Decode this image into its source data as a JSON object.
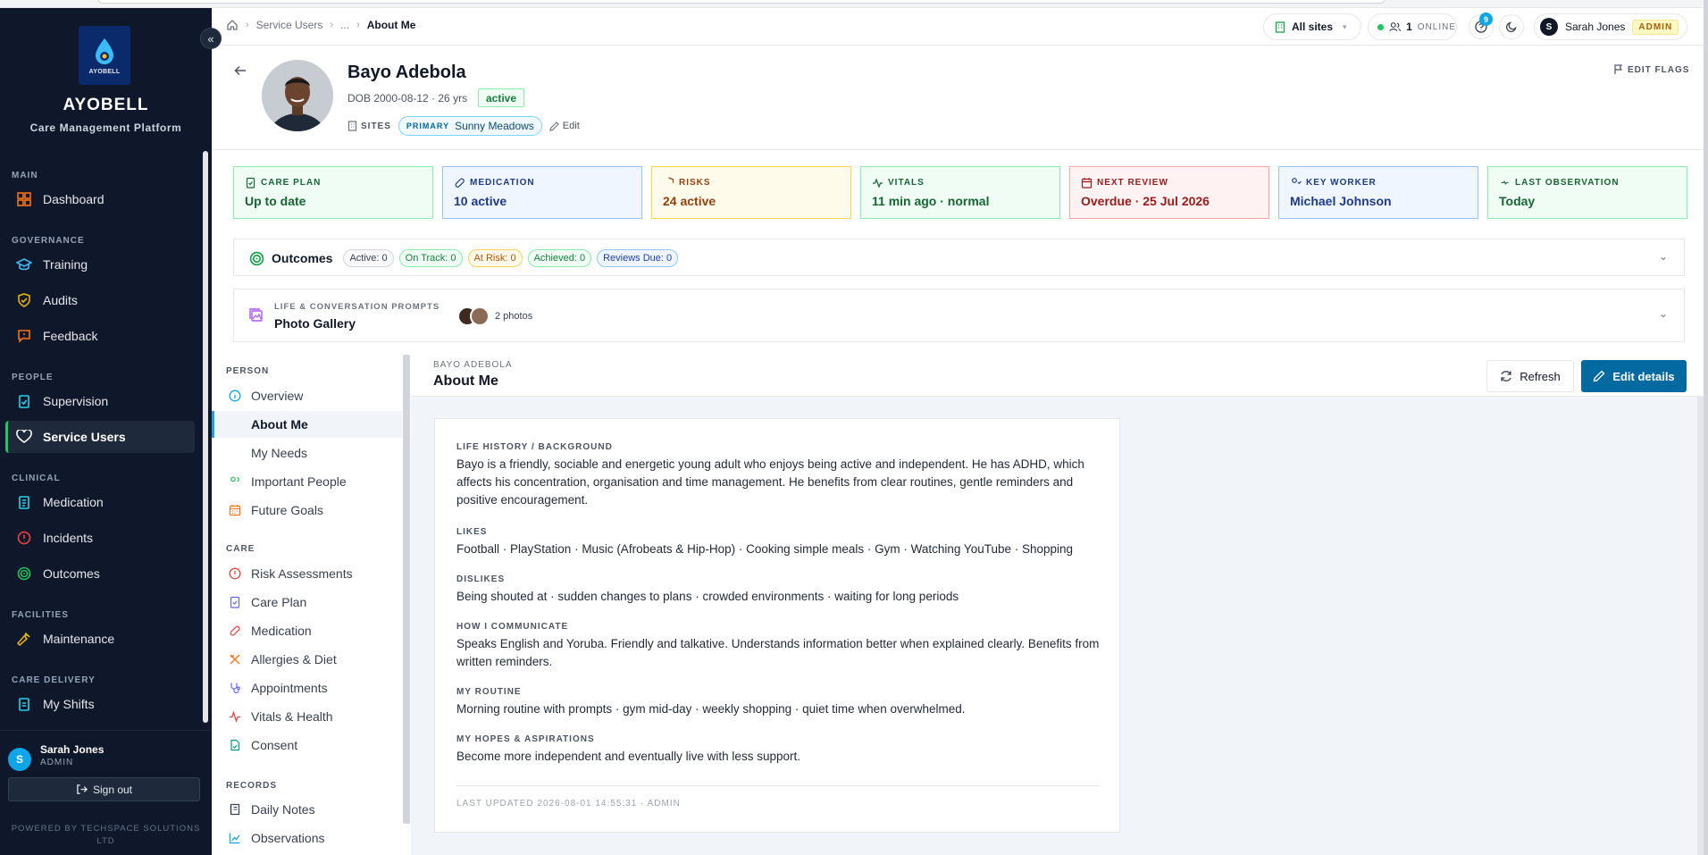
{
  "brand": {
    "logo_text": "AYOBELL",
    "name": "AYOBELL",
    "subtitle": "Care Management Platform"
  },
  "sidebar": {
    "sections": [
      {
        "label": "MAIN"
      },
      {
        "label": "GOVERNANCE"
      },
      {
        "label": "PEOPLE"
      },
      {
        "label": "CLINICAL"
      },
      {
        "label": "FACILITIES"
      },
      {
        "label": "CARE DELIVERY"
      }
    ],
    "items": [
      {
        "label": "Dashboard",
        "icon": "grid-icon",
        "color": "#f97316"
      },
      {
        "label": "Training",
        "icon": "graduation-cap-icon",
        "color": "#38bdf8"
      },
      {
        "label": "Audits",
        "icon": "shield-check-icon",
        "color": "#eab308"
      },
      {
        "label": "Feedback",
        "icon": "message-icon",
        "color": "#f97316"
      },
      {
        "label": "Supervision",
        "icon": "clipboard-check-icon",
        "color": "#22d3ee"
      },
      {
        "label": "Service Users",
        "icon": "heart-handshake-icon",
        "color": "#ffffff"
      },
      {
        "label": "Medication",
        "icon": "clipboard-icon",
        "color": "#22d3ee"
      },
      {
        "label": "Incidents",
        "icon": "alert-circle-icon",
        "color": "#ef4444"
      },
      {
        "label": "Outcomes",
        "icon": "target-icon",
        "color": "#22c55e"
      },
      {
        "label": "Maintenance",
        "icon": "wrench-icon",
        "color": "#eab308"
      },
      {
        "label": "My Shifts",
        "icon": "clipboard-list-icon",
        "color": "#22d3ee"
      }
    ],
    "user": {
      "initial": "S",
      "name": "Sarah Jones",
      "role": "ADMIN"
    },
    "sign_out": "Sign out",
    "powered_by": "POWERED BY TECHSPACE SOLUTIONS LTD"
  },
  "topbar": {
    "breadcrumbs": [
      "Service Users",
      "...",
      "About Me"
    ],
    "site_select": "All sites",
    "online_count": "1",
    "online_label": "ONLINE",
    "notification_count": "9",
    "user": {
      "initial": "S",
      "name": "Sarah Jones",
      "role": "ADMIN"
    }
  },
  "profile": {
    "name": "Bayo Adebola",
    "dob": "DOB 2000-08-12 · 26 yrs",
    "status": "active",
    "sites_label": "SITES",
    "primary_label": "PRIMARY",
    "primary_site": "Sunny Meadows",
    "edit": "Edit",
    "edit_flags": "EDIT FLAGS"
  },
  "cards": [
    {
      "title": "CARE PLAN",
      "value": "Up to date",
      "icon": "clipboard-check-icon",
      "bg": "#f0fdf4",
      "border": "#86efac",
      "color": "#166534"
    },
    {
      "title": "MEDICATION",
      "value": "10 active",
      "icon": "pill-icon",
      "bg": "#eff6ff",
      "border": "#93c5fd",
      "color": "#1e3a8a"
    },
    {
      "title": "RISKS",
      "value": "24 active",
      "icon": "shield-icon",
      "bg": "#fffbeb",
      "border": "#fcd34d",
      "color": "#92400e"
    },
    {
      "title": "VITALS",
      "value": "11 min ago · normal",
      "icon": "activity-icon",
      "bg": "#f0fdf4",
      "border": "#86efac",
      "color": "#166534"
    },
    {
      "title": "NEXT REVIEW",
      "value": "Overdue · 25 Jul 2026",
      "icon": "calendar-icon",
      "bg": "#fef2f2",
      "border": "#fca5a5",
      "color": "#991b1b"
    },
    {
      "title": "KEY WORKER",
      "value": "Michael Johnson",
      "icon": "user-check-icon",
      "bg": "#eff6ff",
      "border": "#93c5fd",
      "color": "#1e3a8a"
    },
    {
      "title": "LAST OBSERVATION",
      "value": "Today",
      "icon": "heart-pulse-icon",
      "bg": "#f0fdf4",
      "border": "#86efac",
      "color": "#166534"
    }
  ],
  "outcomes": {
    "title": "Outcomes",
    "chips": [
      {
        "label": "Active: 0",
        "color": "#374151",
        "border": "#d1d5db",
        "bg": "#f9fafb"
      },
      {
        "label": "On Track: 0",
        "color": "#15803d",
        "border": "#86efac",
        "bg": "#f0fdf4"
      },
      {
        "label": "At Risk: 0",
        "color": "#b45309",
        "border": "#fcd34d",
        "bg": "#fffbeb"
      },
      {
        "label": "Achieved: 0",
        "color": "#15803d",
        "border": "#86efac",
        "bg": "#f0fdf4"
      },
      {
        "label": "Reviews Due: 0",
        "color": "#1e40af",
        "border": "#93c5fd",
        "bg": "#eff6ff"
      }
    ]
  },
  "gallery": {
    "eyebrow": "LIFE & CONVERSATION PROMPTS",
    "title": "Photo Gallery",
    "count": "2 photos"
  },
  "subnav": {
    "sections": [
      {
        "label": "PERSON"
      },
      {
        "label": "CARE"
      },
      {
        "label": "RECORDS"
      }
    ],
    "items": [
      {
        "label": "Overview",
        "icon": "info-icon",
        "color": "#0ea5e9"
      },
      {
        "label": "About Me",
        "icon": "book-open-icon",
        "color": "#6366f1"
      },
      {
        "label": "My Needs",
        "icon": "heart-handshake-icon",
        "color": "#ef4444"
      },
      {
        "label": "Important People",
        "icon": "users-icon",
        "color": "#22c55e"
      },
      {
        "label": "Future Goals",
        "icon": "calendar-icon",
        "color": "#f97316"
      },
      {
        "label": "Risk Assessments",
        "icon": "alert-circle-icon",
        "color": "#ef4444"
      },
      {
        "label": "Care Plan",
        "icon": "clipboard-check-icon",
        "color": "#6366f1"
      },
      {
        "label": "Medication",
        "icon": "pill-icon",
        "color": "#ef4444"
      },
      {
        "label": "Allergies & Diet",
        "icon": "utensils-icon",
        "color": "#f97316"
      },
      {
        "label": "Appointments",
        "icon": "stethoscope-icon",
        "color": "#6366f1"
      },
      {
        "label": "Vitals & Health",
        "icon": "activity-icon",
        "color": "#ef4444"
      },
      {
        "label": "Consent",
        "icon": "file-check-icon",
        "color": "#0d9488"
      },
      {
        "label": "Daily Notes",
        "icon": "notebook-icon",
        "color": "#374151"
      },
      {
        "label": "Observations",
        "icon": "chart-line-icon",
        "color": "#0ea5e9"
      }
    ]
  },
  "content": {
    "eyebrow": "BAYO ADEBOLA",
    "title": "About Me",
    "refresh": "Refresh",
    "edit_details": "Edit details",
    "sections": [
      {
        "label": "LIFE HISTORY / BACKGROUND",
        "text": "Bayo is a friendly, sociable and energetic young adult who enjoys being active and independent. He has ADHD, which affects his concentration, organisation and time management. He benefits from clear routines, gentle reminders and positive encouragement."
      },
      {
        "label": "LIKES",
        "text": "Football · PlayStation · Music (Afrobeats & Hip-Hop) · Cooking simple meals · Gym · Watching YouTube · Shopping"
      },
      {
        "label": "DISLIKES",
        "text": "Being shouted at · sudden changes to plans · crowded environments · waiting for long periods"
      },
      {
        "label": "HOW I COMMUNICATE",
        "text": "Speaks English and Yoruba. Friendly and talkative. Understands information better when explained clearly. Benefits from written reminders."
      },
      {
        "label": "MY ROUTINE",
        "text": "Morning routine with prompts · gym mid-day · weekly shopping · quiet time when overwhelmed."
      },
      {
        "label": "MY HOPES & ASPIRATIONS",
        "text": "Become more independent and eventually live with less support."
      }
    ],
    "last_updated": "LAST UPDATED 2026-08-01 14:55:31 · ADMIN"
  }
}
